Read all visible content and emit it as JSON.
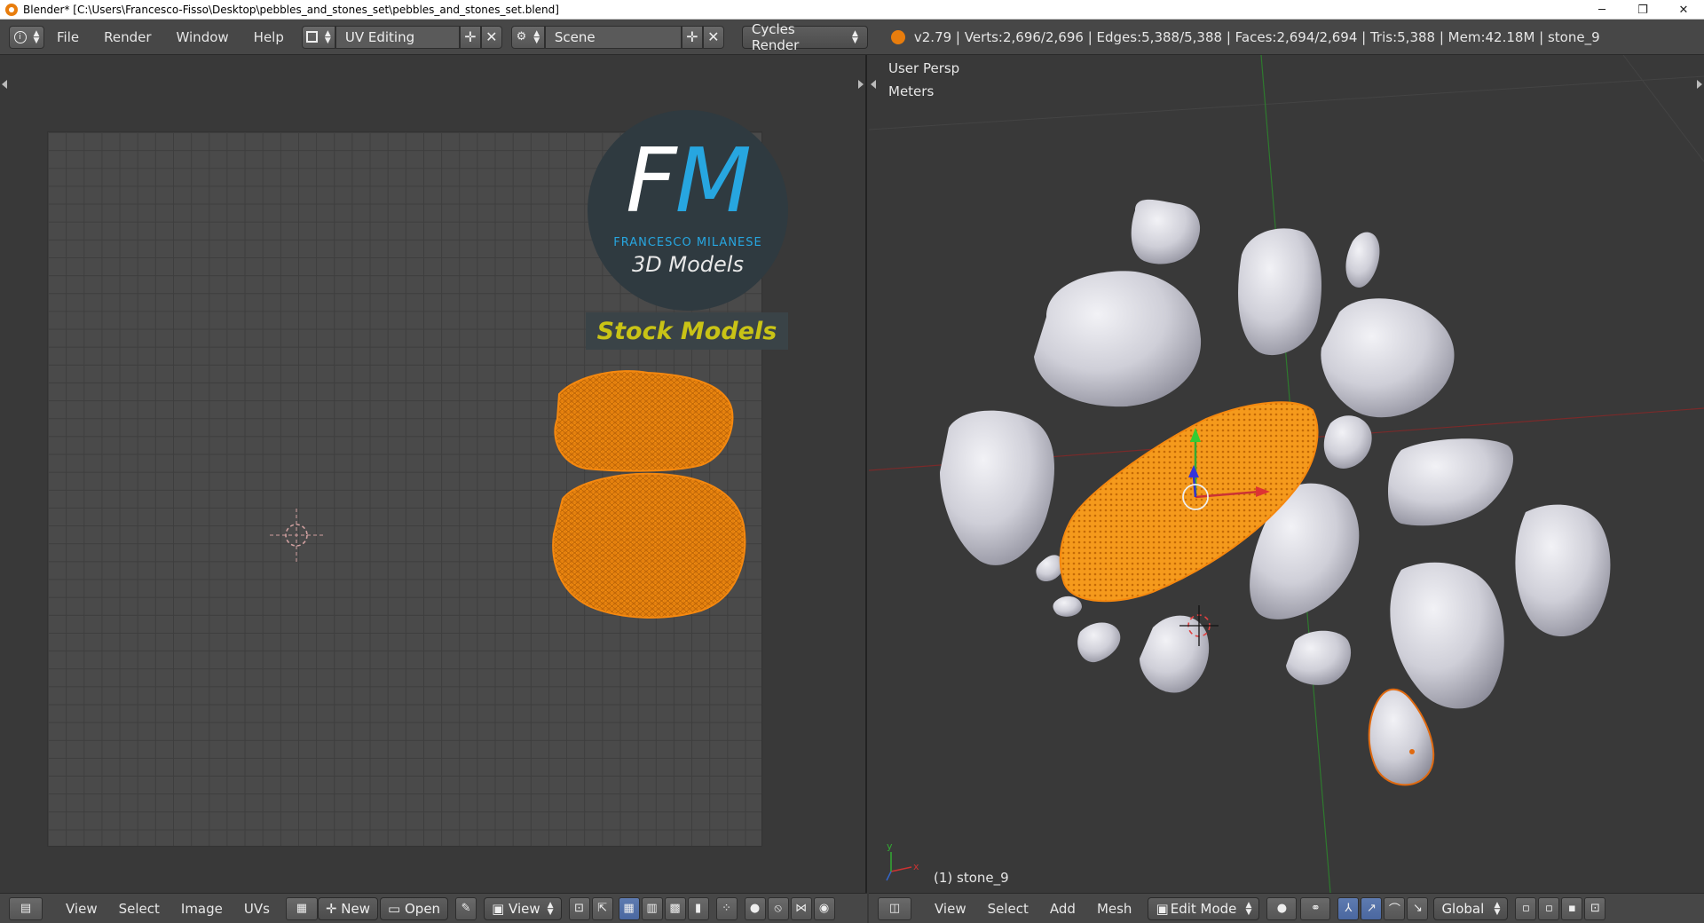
{
  "window": {
    "title": "Blender* [C:\\Users\\Francesco-Fisso\\Desktop\\pebbles_and_stones_set\\pebbles_and_stones_set.blend]",
    "minimize": "─",
    "restore": "❐",
    "close": "✕"
  },
  "header": {
    "menus": [
      "File",
      "Render",
      "Window",
      "Help"
    ],
    "screen_layout": "UV Editing",
    "scene": "Scene",
    "render_engine": "Cycles Render",
    "stats": "v2.79 | Verts:2,696/2,696 | Edges:5,388/5,388 | Faces:2,694/2,694 | Tris:5,388 | Mem:42.18M | stone_9"
  },
  "watermark": {
    "letter_f": "F",
    "letter_m": "M",
    "name": "FRANCESCO MILANESE",
    "tagline": "3D Models",
    "banner": "Stock Models"
  },
  "viewport": {
    "view_name": "User Persp",
    "units": "Meters",
    "object_label": "(1) stone_9"
  },
  "uv_footer": {
    "menus": [
      "View",
      "Select",
      "Image",
      "UVs"
    ],
    "new_label": "New",
    "open_label": "Open",
    "view_label": "View"
  },
  "view3d_footer": {
    "menus": [
      "View",
      "Select",
      "Add",
      "Mesh"
    ],
    "mode": "Edit Mode",
    "orientation": "Global"
  },
  "colors": {
    "selection_orange": "#f5880f",
    "stone_gray": "#c9c9d2",
    "logo_blue": "#27a6e0",
    "banner_yellow": "#c9c316"
  }
}
